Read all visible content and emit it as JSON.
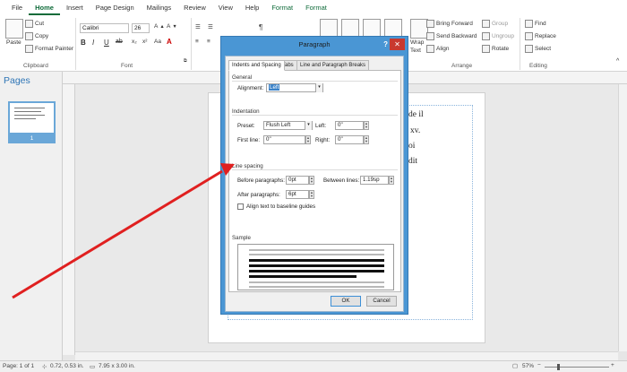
{
  "ribbon": {
    "tabs": [
      {
        "label": "File"
      },
      {
        "label": "Home"
      },
      {
        "label": "Insert"
      },
      {
        "label": "Page Design"
      },
      {
        "label": "Mailings"
      },
      {
        "label": "Review"
      },
      {
        "label": "View"
      },
      {
        "label": "Help"
      },
      {
        "label": "Format"
      },
      {
        "label": "Format"
      }
    ],
    "clipboard": {
      "paste": "Paste",
      "cut": "Cut",
      "copy": "Copy",
      "format_painter": "Format Painter",
      "group_label": "Clipboard"
    },
    "font": {
      "family": "Calibri",
      "size": "26",
      "bold": "B",
      "italic": "I",
      "underline": "U",
      "strike": "ab",
      "group_label": "Font"
    },
    "paragraph": {
      "pilcrow": "¶"
    },
    "objects": {
      "wrap": "Wrap",
      "text": "Text"
    },
    "arrange": {
      "bring_forward": "Bring Forward",
      "send_backward": "Send Backward",
      "align": "Align",
      "group": "Group",
      "ungroup": "Ungroup",
      "rotate": "Rotate",
      "group_label": "Arrange"
    },
    "editing": {
      "find": "Find",
      "replace": "Replace",
      "select": "Select",
      "group_label": "Editing"
    }
  },
  "pages_pane": {
    "title": "Pages",
    "page_number": "1"
  },
  "document": {
    "lines": [
      "de il",
      "xv.",
      "oi",
      "dit"
    ]
  },
  "status": {
    "page": "Page: 1 of 1",
    "position": "0.72, 0.53 in.",
    "size": "7.95 x 3.00 in.",
    "zoom": "57%"
  },
  "dialog": {
    "title": "Paragraph",
    "help": "?",
    "close": "✕",
    "tabs": [
      "Indents and Spacing",
      "Tabs",
      "Line and Paragraph Breaks"
    ],
    "general": {
      "heading": "General",
      "alignment_label": "Alignment:",
      "alignment_value": "Left"
    },
    "indentation": {
      "heading": "Indentation",
      "preset_label": "Preset:",
      "preset_value": "Flush Left",
      "left_label": "Left:",
      "left_value": "0\"",
      "first_line_label": "First line:",
      "first_line_value": "0\"",
      "right_label": "Right:",
      "right_value": "0\""
    },
    "line_spacing": {
      "heading": "Line spacing",
      "before_label": "Before paragraphs:",
      "before_value": "0pt",
      "between_label": "Between lines:",
      "between_value": "1.19sp",
      "after_label": "After paragraphs:",
      "after_value": "6pt",
      "baseline_label": "Align text to baseline guides"
    },
    "sample_heading": "Sample",
    "ok": "OK",
    "cancel": "Cancel"
  },
  "colors": {
    "accent": "#0f6b3a",
    "dialog_frame": "#4a96d4",
    "arrow": "#e02020",
    "pages_blue": "#2e75b6"
  }
}
